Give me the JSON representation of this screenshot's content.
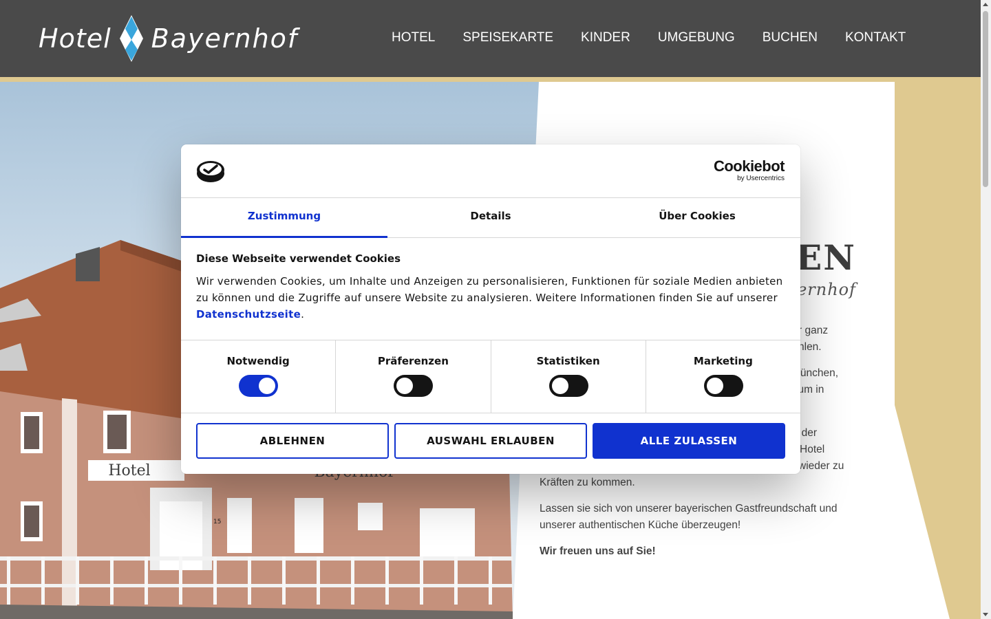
{
  "header": {
    "logo": {
      "word1": "Hotel",
      "word2": "Bayernhof"
    },
    "nav": [
      "HOTEL",
      "SPEISEKARTE",
      "KINDER",
      "UMGEBUNG",
      "BUCHEN",
      "KONTAKT"
    ]
  },
  "hero": {
    "title_fragment": "EN",
    "subtitle_fragment": "ernhof",
    "sign_left": "Hotel",
    "sign_right": "Bayernhof",
    "house_number": "15",
    "paragraphs": [
      {
        "lines": [
          "r ganz",
          "hlen."
        ]
      },
      {
        "lines": [
          "München,",
          "trum in"
        ]
      },
      {
        "lines": [
          "f der",
          "Hotel",
          "wieder zu",
          "Kräften zu kommen."
        ]
      },
      {
        "lines": [
          "Lassen sie sich von unserer bayerischen Gastfreundschaft und",
          "unserer authentischen Küche überzeugen!"
        ]
      },
      {
        "lines": [
          "Wir freuen uns auf Sie!"
        ]
      }
    ]
  },
  "cookie_dialog": {
    "brand": {
      "name": "Cookiebot",
      "by": "by Usercentrics"
    },
    "tabs": [
      "Zustimmung",
      "Details",
      "Über Cookies"
    ],
    "active_tab": "Zustimmung",
    "heading": "Diese Webseite verwendet Cookies",
    "text_before_link": "Wir verwenden Cookies, um Inhalte und Anzeigen zu personalisieren, Funktionen für soziale Medien anbieten zu können und die Zugriffe auf unsere Website zu analysieren. Weitere Informationen finden Sie auf unserer ",
    "link_text": "Datenschutzseite",
    "text_after_link": ".",
    "categories": [
      {
        "label": "Notwendig",
        "enabled": true
      },
      {
        "label": "Präferenzen",
        "enabled": false
      },
      {
        "label": "Statistiken",
        "enabled": false
      },
      {
        "label": "Marketing",
        "enabled": false
      }
    ],
    "buttons": {
      "decline": "ABLEHNEN",
      "allow_selection": "AUSWAHL ERLAUBEN",
      "allow_all": "ALLE ZULASSEN"
    }
  },
  "colors": {
    "header_bg": "#4a4a4a",
    "gold_accent": "#dfc990",
    "cookiebot_blue": "#1032cf",
    "logo_diamond": "#3aa6dc"
  },
  "icons": [
    "cookiebot-logo-icon",
    "logo-diamond-icon"
  ]
}
